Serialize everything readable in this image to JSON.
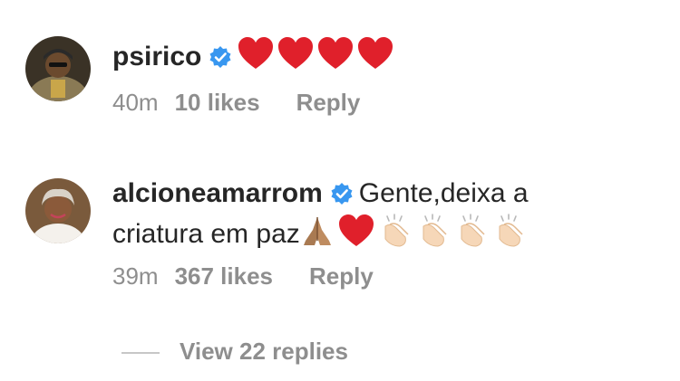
{
  "comments": [
    {
      "username": "psirico",
      "verified": true,
      "text": "",
      "emojis": [
        "red-heart",
        "red-heart",
        "red-heart",
        "red-heart"
      ],
      "time": "40m",
      "likes": "10 likes",
      "reply": "Reply"
    },
    {
      "username": "alcioneamarrom",
      "verified": true,
      "text_line1": "Gente,deixa a",
      "text_line2": "criatura em paz",
      "emojis": [
        "folded-hands",
        "red-heart",
        "clapping-hands",
        "clapping-hands",
        "clapping-hands",
        "clapping-hands"
      ],
      "time": "39m",
      "likes": "367 likes",
      "reply": "Reply"
    }
  ],
  "view_replies": "View 22 replies",
  "colors": {
    "text": "#262626",
    "meta": "#8e8e8e",
    "verified": "#3897f0",
    "heart": "#e0202b"
  }
}
